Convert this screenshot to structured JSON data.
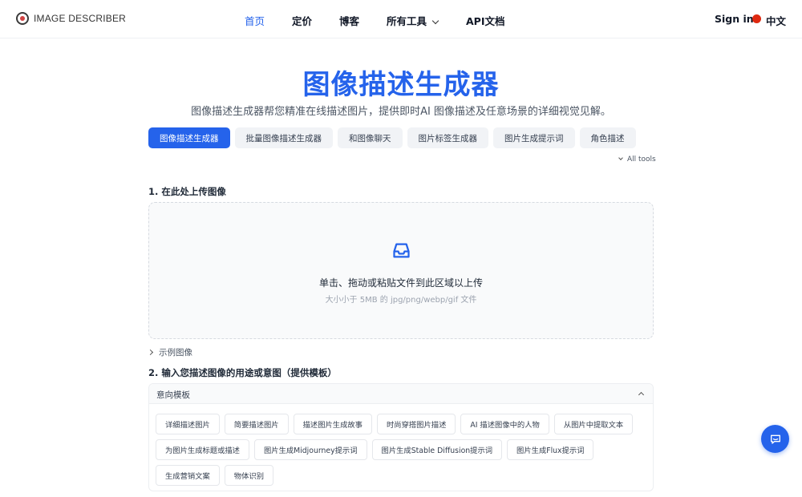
{
  "brand": {
    "name": "IMAGE DESCRIBER",
    "accent": "#2563eb"
  },
  "nav": {
    "items": [
      {
        "label": "首页",
        "active": true
      },
      {
        "label": "定价"
      },
      {
        "label": "博客"
      },
      {
        "label": "所有工具"
      },
      {
        "label": "API文档"
      }
    ],
    "sign_in": "Sign in",
    "language": "中文"
  },
  "hero": {
    "title": "图像描述生成器",
    "subtitle": "图像描述生成器帮您精准在线描述图片，提供即时AI 图像描述及任意场景的详细视觉见解。"
  },
  "tool_tabs": [
    {
      "label": "图像描述生成器",
      "active": true
    },
    {
      "label": "批量图像描述生成器"
    },
    {
      "label": "和图像聊天"
    },
    {
      "label": "图片标签生成器"
    },
    {
      "label": "图片生成提示词"
    },
    {
      "label": "角色描述"
    }
  ],
  "all_tools": "All tools",
  "upload": {
    "label": "1. 在此处上传图像",
    "main_text": "单击、拖动或粘贴文件到此区域以上传",
    "hint": "大小小于 5MB 的 jpg/png/webp/gif 文件"
  },
  "examples_label": "示例图像",
  "purpose": {
    "label": "2. 输入您描述图像的用途或意图（提供模板）",
    "panel_title": "意向模板",
    "templates": [
      "详细描述图片",
      "简要描述图片",
      "描述图片生成故事",
      "时尚穿搭图片描述",
      "AI 描述图像中的人物",
      "从图片中提取文本",
      "为图片生成标题或描述",
      "图片生成Midjourney提示词",
      "图片生成Stable Diffusion提示词",
      "图片生成Flux提示词",
      "生成营销文案",
      "物体识别"
    ]
  }
}
